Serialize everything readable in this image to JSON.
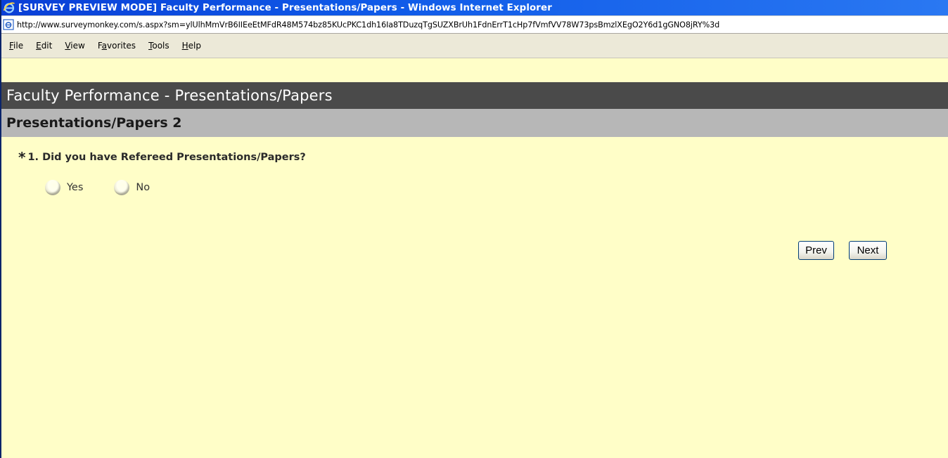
{
  "window": {
    "title": "[SURVEY PREVIEW MODE] Faculty Performance - Presentations/Papers - Windows Internet Explorer"
  },
  "address_bar": {
    "url": "http://www.surveymonkey.com/s.aspx?sm=ylUlhMmVrB6IIEeEtMFdR48M574bz85KUcPKC1dh16Ia8TDuzqTgSUZXBrUh1FdnErrT1cHp7fVmfVV78W73psBmzlXEgO2Y6d1gGNO8jRY%3d"
  },
  "menu": {
    "items": [
      {
        "pre": "",
        "key": "F",
        "post": "ile"
      },
      {
        "pre": "",
        "key": "E",
        "post": "dit"
      },
      {
        "pre": "",
        "key": "V",
        "post": "iew"
      },
      {
        "pre": "F",
        "key": "a",
        "post": "vorites"
      },
      {
        "pre": "",
        "key": "T",
        "post": "ools"
      },
      {
        "pre": "",
        "key": "H",
        "post": "elp"
      }
    ]
  },
  "survey": {
    "title": "Faculty Performance - Presentations/Papers",
    "page_heading": "Presentations/Papers 2",
    "question": {
      "required_marker": "*",
      "text": "1. Did you have Refereed Presentations/Papers?",
      "options": [
        "Yes",
        "No"
      ]
    },
    "buttons": {
      "prev": "Prev",
      "next": "Next"
    }
  },
  "colors": {
    "title_bar": "#0f5ae8",
    "survey_header": "#4a4a4a",
    "page_heading_bar": "#b7b7b7",
    "page_background": "#fffec8"
  },
  "icons": {
    "title_icon": "ie-logo-icon",
    "address_icon": "page-icon"
  }
}
